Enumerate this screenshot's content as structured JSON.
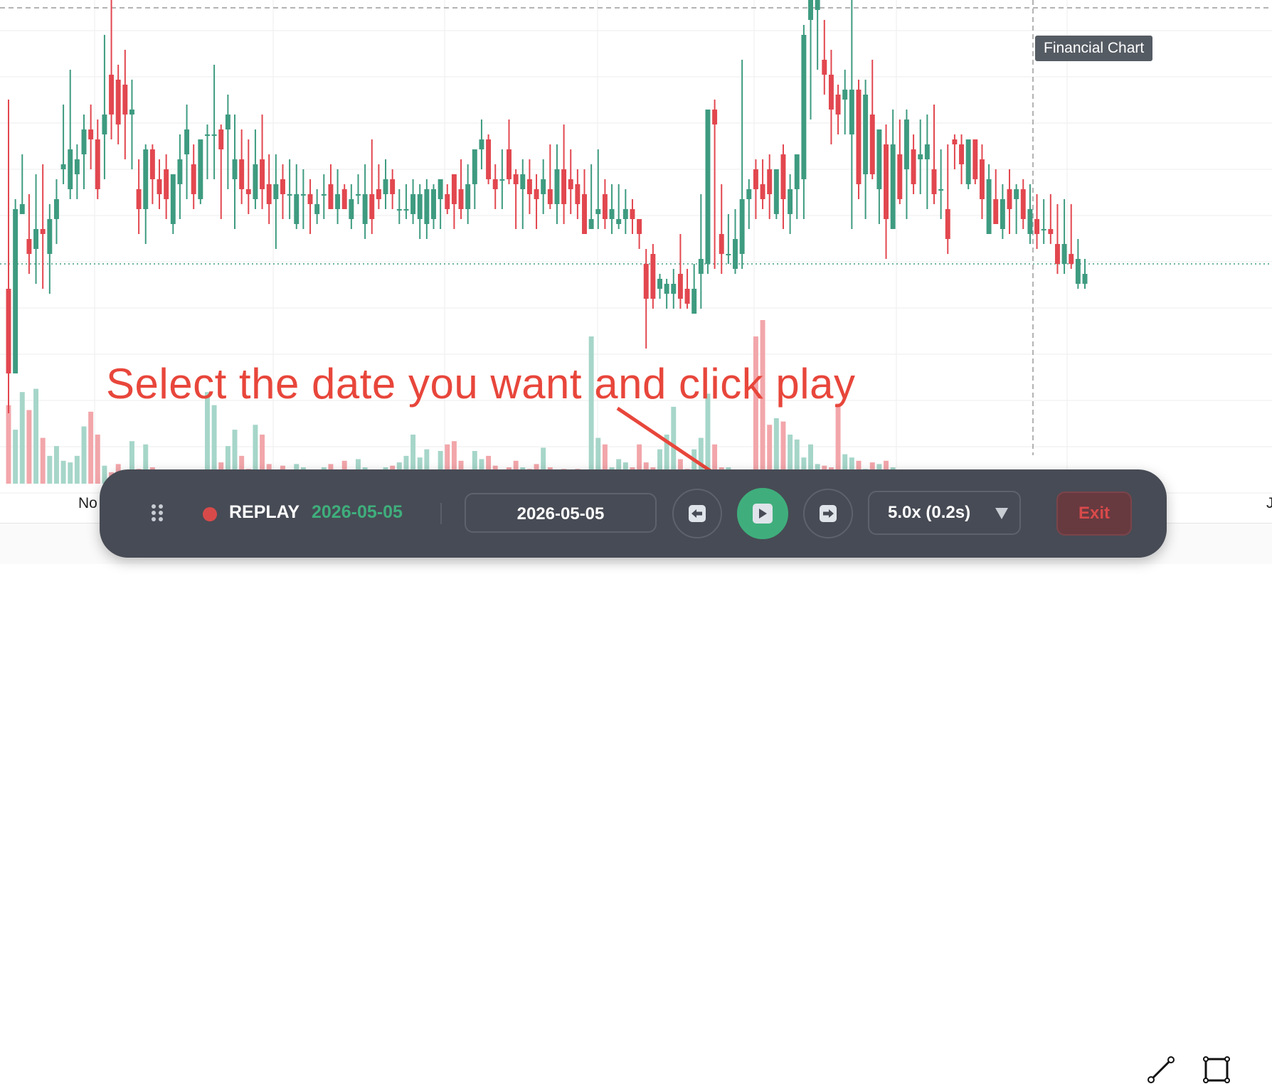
{
  "tooltip": "Financial Chart",
  "x_axis_labels": {
    "left": "No",
    "right": "J"
  },
  "annotation": "Select the date you want and click play",
  "replay_bar": {
    "status_label": "REPLAY",
    "current_date": "2026-05-05",
    "date_input_value": "2026-05-05",
    "speed_value": "5.0x (0.2s)",
    "exit_label": "Exit",
    "icons": [
      "drag-handle-icon",
      "record-dot-icon",
      "step-back-icon",
      "play-icon",
      "step-forward-icon",
      "chevron-down-icon"
    ]
  },
  "colors": {
    "up": "#3e9b80",
    "down": "#e2474f",
    "up_volume": "#a6d6c9",
    "down_volume": "#f2a6aa",
    "accent_green": "#3fae7c",
    "bar_bg": "#474b55",
    "annotation": "#e8463b"
  },
  "chart_data": {
    "type": "candlestick",
    "price_scale": [
      0,
      100
    ],
    "volume_scale": [
      0,
      100
    ],
    "reference_price": 47,
    "candles": [
      {
        "o": 42,
        "h": 80,
        "l": 17,
        "c": 25
      },
      {
        "o": 25,
        "h": 60,
        "l": 25,
        "c": 58
      },
      {
        "o": 57,
        "h": 69,
        "l": 57,
        "c": 59
      },
      {
        "o": 52,
        "h": 61,
        "l": 45,
        "c": 49
      },
      {
        "o": 50,
        "h": 65,
        "l": 43,
        "c": 54
      },
      {
        "o": 54,
        "h": 67,
        "l": 42,
        "c": 53
      },
      {
        "o": 49,
        "h": 59,
        "l": 41,
        "c": 56
      },
      {
        "o": 56,
        "h": 64,
        "l": 51,
        "c": 60
      },
      {
        "o": 66,
        "h": 79,
        "l": 63,
        "c": 67
      },
      {
        "o": 62,
        "h": 86,
        "l": 60,
        "c": 70
      },
      {
        "o": 65,
        "h": 71,
        "l": 60,
        "c": 68
      },
      {
        "o": 69,
        "h": 77,
        "l": 62,
        "c": 74
      },
      {
        "o": 74,
        "h": 79,
        "l": 66,
        "c": 72
      },
      {
        "o": 72,
        "h": 76,
        "l": 60,
        "c": 62
      },
      {
        "o": 73,
        "h": 93,
        "l": 64,
        "c": 77
      },
      {
        "o": 85,
        "h": 100,
        "l": 72,
        "c": 77
      },
      {
        "o": 84,
        "h": 87,
        "l": 71,
        "c": 75
      },
      {
        "o": 83,
        "h": 90,
        "l": 68,
        "c": 77
      },
      {
        "o": 77,
        "h": 84,
        "l": 66,
        "c": 78
      },
      {
        "o": 62,
        "h": 68,
        "l": 53,
        "c": 58
      },
      {
        "o": 58,
        "h": 71,
        "l": 51,
        "c": 70
      },
      {
        "o": 70,
        "h": 71,
        "l": 59,
        "c": 64
      },
      {
        "o": 64,
        "h": 68,
        "l": 58,
        "c": 61
      },
      {
        "o": 66,
        "h": 69,
        "l": 56,
        "c": 60
      },
      {
        "o": 55,
        "h": 65,
        "l": 53,
        "c": 65
      },
      {
        "o": 63,
        "h": 73,
        "l": 56,
        "c": 68
      },
      {
        "o": 69,
        "h": 79,
        "l": 60,
        "c": 74
      },
      {
        "o": 67,
        "h": 71,
        "l": 58,
        "c": 61
      },
      {
        "o": 60,
        "h": 71,
        "l": 59,
        "c": 72
      },
      {
        "o": 73,
        "h": 75,
        "l": 64,
        "c": 73
      },
      {
        "o": 73,
        "h": 87,
        "l": 64,
        "c": 73
      },
      {
        "o": 74,
        "h": 75,
        "l": 56,
        "c": 70
      },
      {
        "o": 74,
        "h": 81,
        "l": 62,
        "c": 77
      },
      {
        "o": 64,
        "h": 77,
        "l": 54,
        "c": 68
      },
      {
        "o": 68,
        "h": 74,
        "l": 59,
        "c": 62
      },
      {
        "o": 62,
        "h": 72,
        "l": 57,
        "c": 61
      },
      {
        "o": 60,
        "h": 74,
        "l": 58,
        "c": 67
      },
      {
        "o": 68,
        "h": 77,
        "l": 58,
        "c": 62
      },
      {
        "o": 63,
        "h": 69,
        "l": 55,
        "c": 59
      },
      {
        "o": 60,
        "h": 69,
        "l": 50,
        "c": 63
      },
      {
        "o": 64,
        "h": 67,
        "l": 56,
        "c": 61
      },
      {
        "o": 61,
        "h": 68,
        "l": 56,
        "c": 61
      },
      {
        "o": 55,
        "h": 67,
        "l": 54,
        "c": 61
      },
      {
        "o": 61,
        "h": 66,
        "l": 54,
        "c": 61
      },
      {
        "o": 61,
        "h": 64,
        "l": 53,
        "c": 59
      },
      {
        "o": 57,
        "h": 62,
        "l": 55,
        "c": 59
      },
      {
        "o": 61,
        "h": 65,
        "l": 56,
        "c": 61
      },
      {
        "o": 63,
        "h": 67,
        "l": 58,
        "c": 58
      },
      {
        "o": 58,
        "h": 66,
        "l": 55,
        "c": 61
      },
      {
        "o": 62,
        "h": 63,
        "l": 58,
        "c": 58
      },
      {
        "o": 56,
        "h": 63,
        "l": 54,
        "c": 60
      },
      {
        "o": 61,
        "h": 65,
        "l": 59,
        "c": 61
      },
      {
        "o": 55,
        "h": 67,
        "l": 52,
        "c": 61
      },
      {
        "o": 61,
        "h": 72,
        "l": 53,
        "c": 56
      },
      {
        "o": 62,
        "h": 67,
        "l": 58,
        "c": 60
      },
      {
        "o": 61,
        "h": 68,
        "l": 58,
        "c": 64
      },
      {
        "o": 64,
        "h": 66,
        "l": 58,
        "c": 61
      },
      {
        "o": 58,
        "h": 62,
        "l": 55,
        "c": 58
      },
      {
        "o": 58,
        "h": 63,
        "l": 56,
        "c": 58
      },
      {
        "o": 57,
        "h": 64,
        "l": 55,
        "c": 61
      },
      {
        "o": 56,
        "h": 63,
        "l": 52,
        "c": 61
      },
      {
        "o": 55,
        "h": 64,
        "l": 52,
        "c": 62
      },
      {
        "o": 56,
        "h": 63,
        "l": 54,
        "c": 62
      },
      {
        "o": 60,
        "h": 64,
        "l": 54,
        "c": 64
      },
      {
        "o": 61,
        "h": 63,
        "l": 57,
        "c": 58
      },
      {
        "o": 65,
        "h": 65,
        "l": 54,
        "c": 59
      },
      {
        "o": 62,
        "h": 68,
        "l": 56,
        "c": 58
      },
      {
        "o": 58,
        "h": 67,
        "l": 55,
        "c": 63
      },
      {
        "o": 63,
        "h": 68,
        "l": 58,
        "c": 70
      },
      {
        "o": 70,
        "h": 76,
        "l": 66,
        "c": 72
      },
      {
        "o": 72,
        "h": 73,
        "l": 63,
        "c": 64
      },
      {
        "o": 64,
        "h": 67,
        "l": 58,
        "c": 62
      },
      {
        "o": 64,
        "h": 70,
        "l": 58,
        "c": 64
      },
      {
        "o": 70,
        "h": 76,
        "l": 63,
        "c": 64
      },
      {
        "o": 65,
        "h": 66,
        "l": 54,
        "c": 63
      },
      {
        "o": 62,
        "h": 68,
        "l": 54,
        "c": 65
      },
      {
        "o": 64,
        "h": 68,
        "l": 57,
        "c": 61
      },
      {
        "o": 62,
        "h": 65,
        "l": 54,
        "c": 60
      },
      {
        "o": 61,
        "h": 68,
        "l": 57,
        "c": 64
      },
      {
        "o": 62,
        "h": 71,
        "l": 58,
        "c": 59
      },
      {
        "o": 59,
        "h": 71,
        "l": 55,
        "c": 66
      },
      {
        "o": 66,
        "h": 75,
        "l": 55,
        "c": 59
      },
      {
        "o": 64,
        "h": 70,
        "l": 57,
        "c": 62
      },
      {
        "o": 63,
        "h": 66,
        "l": 56,
        "c": 59
      },
      {
        "o": 61,
        "h": 66,
        "l": 53,
        "c": 53
      },
      {
        "o": 54,
        "h": 67,
        "l": 54,
        "c": 56
      },
      {
        "o": 57,
        "h": 70,
        "l": 54,
        "c": 58
      },
      {
        "o": 61,
        "h": 64,
        "l": 54,
        "c": 56
      },
      {
        "o": 56,
        "h": 63,
        "l": 53,
        "c": 58
      },
      {
        "o": 55,
        "h": 63,
        "l": 54,
        "c": 56
      },
      {
        "o": 56,
        "h": 62,
        "l": 53,
        "c": 58
      },
      {
        "o": 58,
        "h": 60,
        "l": 53,
        "c": 56
      },
      {
        "o": 56,
        "h": 56,
        "l": 50,
        "c": 53
      },
      {
        "o": 47,
        "h": 50,
        "l": 30,
        "c": 40
      },
      {
        "o": 49,
        "h": 51,
        "l": 38,
        "c": 40
      },
      {
        "o": 42,
        "h": 45,
        "l": 40,
        "c": 44
      },
      {
        "o": 41,
        "h": 44,
        "l": 38,
        "c": 43
      },
      {
        "o": 41,
        "h": 46,
        "l": 38,
        "c": 43
      },
      {
        "o": 45,
        "h": 53,
        "l": 38,
        "c": 40
      },
      {
        "o": 42,
        "h": 46,
        "l": 38,
        "c": 39
      },
      {
        "o": 37,
        "h": 47,
        "l": 37,
        "c": 42
      },
      {
        "o": 45,
        "h": 61,
        "l": 38,
        "c": 48
      },
      {
        "o": 47,
        "h": 71,
        "l": 45,
        "c": 78
      },
      {
        "o": 78,
        "h": 80,
        "l": 46,
        "c": 75
      },
      {
        "o": 53,
        "h": 63,
        "l": 45,
        "c": 49
      },
      {
        "o": 49,
        "h": 57,
        "l": 47,
        "c": 49
      },
      {
        "o": 46,
        "h": 58,
        "l": 45,
        "c": 52
      },
      {
        "o": 49,
        "h": 88,
        "l": 46,
        "c": 60
      },
      {
        "o": 60,
        "h": 64,
        "l": 54,
        "c": 62
      },
      {
        "o": 66,
        "h": 68,
        "l": 56,
        "c": 62
      },
      {
        "o": 63,
        "h": 68,
        "l": 58,
        "c": 60
      },
      {
        "o": 66,
        "h": 69,
        "l": 56,
        "c": 61
      },
      {
        "o": 57,
        "h": 65,
        "l": 56,
        "c": 66
      },
      {
        "o": 69,
        "h": 71,
        "l": 54,
        "c": 60
      },
      {
        "o": 57,
        "h": 65,
        "l": 53,
        "c": 62
      },
      {
        "o": 62,
        "h": 66,
        "l": 56,
        "c": 69
      },
      {
        "o": 64,
        "h": 95,
        "l": 56,
        "c": 93
      },
      {
        "o": 96,
        "h": 100,
        "l": 76,
        "c": 100
      },
      {
        "o": 98,
        "h": 100,
        "l": 86,
        "c": 100
      },
      {
        "o": 88,
        "h": 96,
        "l": 81,
        "c": 85
      },
      {
        "o": 85,
        "h": 90,
        "l": 71,
        "c": 78
      },
      {
        "o": 81,
        "h": 83,
        "l": 73,
        "c": 77
      },
      {
        "o": 80,
        "h": 86,
        "l": 73,
        "c": 82
      },
      {
        "o": 73,
        "h": 100,
        "l": 54,
        "c": 82
      },
      {
        "o": 82,
        "h": 84,
        "l": 60,
        "c": 63
      },
      {
        "o": 65,
        "h": 84,
        "l": 56,
        "c": 81
      },
      {
        "o": 77,
        "h": 88,
        "l": 64,
        "c": 65
      },
      {
        "o": 62,
        "h": 74,
        "l": 55,
        "c": 74
      },
      {
        "o": 71,
        "h": 75,
        "l": 48,
        "c": 56
      },
      {
        "o": 54,
        "h": 78,
        "l": 54,
        "c": 71
      },
      {
        "o": 69,
        "h": 76,
        "l": 59,
        "c": 60
      },
      {
        "o": 66,
        "h": 78,
        "l": 56,
        "c": 76
      },
      {
        "o": 70,
        "h": 73,
        "l": 61,
        "c": 63
      },
      {
        "o": 68,
        "h": 76,
        "l": 61,
        "c": 69
      },
      {
        "o": 68,
        "h": 77,
        "l": 58,
        "c": 71
      },
      {
        "o": 66,
        "h": 79,
        "l": 59,
        "c": 61
      },
      {
        "o": 62,
        "h": 70,
        "l": 56,
        "c": 62
      },
      {
        "o": 58,
        "h": 71,
        "l": 49,
        "c": 52
      },
      {
        "o": 72,
        "h": 73,
        "l": 66,
        "c": 71
      },
      {
        "o": 71,
        "h": 73,
        "l": 63,
        "c": 67
      },
      {
        "o": 63,
        "h": 72,
        "l": 62,
        "c": 72
      },
      {
        "o": 72,
        "h": 72,
        "l": 63,
        "c": 64
      },
      {
        "o": 68,
        "h": 71,
        "l": 56,
        "c": 60
      },
      {
        "o": 53,
        "h": 67,
        "l": 53,
        "c": 64
      },
      {
        "o": 60,
        "h": 66,
        "l": 57,
        "c": 55
      },
      {
        "o": 54,
        "h": 63,
        "l": 52,
        "c": 60
      },
      {
        "o": 62,
        "h": 66,
        "l": 53,
        "c": 58
      },
      {
        "o": 60,
        "h": 63,
        "l": 53,
        "c": 62
      },
      {
        "o": 62,
        "h": 64,
        "l": 54,
        "c": 56
      },
      {
        "o": 53,
        "h": 63,
        "l": 51,
        "c": 58
      },
      {
        "o": 56,
        "h": 61,
        "l": 50,
        "c": 53
      },
      {
        "o": 54,
        "h": 60,
        "l": 51,
        "c": 54
      },
      {
        "o": 54,
        "h": 61,
        "l": 51,
        "c": 53
      },
      {
        "o": 51,
        "h": 59,
        "l": 45,
        "c": 47
      },
      {
        "o": 47,
        "h": 60,
        "l": 45,
        "c": 51
      },
      {
        "o": 49,
        "h": 59,
        "l": 46,
        "c": 47
      },
      {
        "o": 43,
        "h": 52,
        "l": 42,
        "c": 48
      },
      {
        "o": 43,
        "h": 48,
        "l": 42,
        "c": 45
      }
    ],
    "volumes_pct": [
      48,
      33,
      56,
      45,
      58,
      28,
      17,
      23,
      14,
      13,
      17,
      35,
      44,
      30,
      11,
      7,
      12,
      5,
      26,
      9,
      24,
      10,
      4,
      4,
      6,
      3,
      3,
      4,
      5,
      56,
      48,
      13,
      23,
      33,
      17,
      9,
      36,
      30,
      12,
      5,
      11,
      7,
      12,
      10,
      7,
      8,
      10,
      12,
      7,
      14,
      8,
      15,
      10,
      8,
      5,
      10,
      11,
      13,
      17,
      30,
      16,
      21,
      8,
      20,
      24,
      26,
      14,
      8,
      20,
      15,
      17,
      11,
      8,
      10,
      14,
      10,
      9,
      12,
      22,
      10,
      7,
      9,
      7,
      9,
      7,
      90,
      28,
      24,
      10,
      15,
      13,
      10,
      24,
      13,
      10,
      21,
      30,
      47,
      15,
      9,
      21,
      28,
      55,
      24,
      10,
      10,
      8,
      5,
      5,
      90,
      100,
      36,
      40,
      38,
      30,
      27,
      16,
      24,
      12,
      11,
      10,
      49,
      18,
      16,
      14,
      9,
      13,
      12,
      14,
      10,
      8,
      8,
      7,
      7,
      5,
      6,
      7,
      8,
      7,
      5,
      6
    ]
  }
}
